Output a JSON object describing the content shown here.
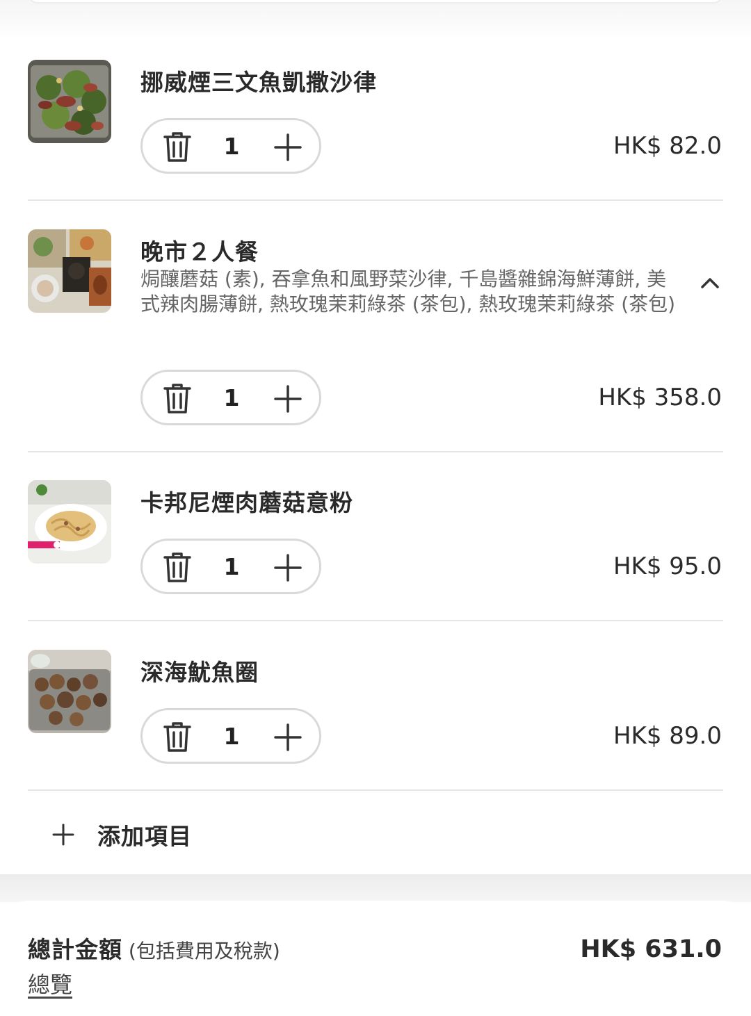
{
  "items": [
    {
      "name": "挪威煙三文魚凱撒沙律",
      "description": "",
      "quantity": "1",
      "price": "HK$ 82.0",
      "image": "salmon-caesar-salad-photo"
    },
    {
      "name": "晚市２人餐",
      "description": "焗釀蘑菇 (素), 吞拿魚和風野菜沙律, 千島醬雜錦海鮮薄餅, 美式辣肉腸薄餅, 熱玫瑰茉莉綠茶 (茶包), 熱玫瑰茉莉綠茶 (茶包)",
      "quantity": "1",
      "price": "HK$ 358.0",
      "image": "dinner-set-for-two-photo"
    },
    {
      "name": "卡邦尼煙肉蘑菇意粉",
      "description": "",
      "quantity": "1",
      "price": "HK$ 95.0",
      "image": "carbonara-pasta-photo"
    },
    {
      "name": "深海魷魚圈",
      "description": "",
      "quantity": "1",
      "price": "HK$ 89.0",
      "image": "squid-rings-photo"
    }
  ],
  "add_item": {
    "label": "添加項目",
    "icon": "plus-icon"
  },
  "total": {
    "label": "總計金額",
    "sub_label": " (包括費用及稅款)",
    "amount": "HK$ 631.0",
    "summary_link": "總覽"
  },
  "icons": {
    "remove": "trash-icon",
    "increase": "plus-icon",
    "collapse": "chevron-up-icon"
  },
  "colors": {
    "divider": "#e6e6e6",
    "stepper_border": "#d9d9d9",
    "text": "#2a2a2a",
    "muted": "#666666"
  }
}
